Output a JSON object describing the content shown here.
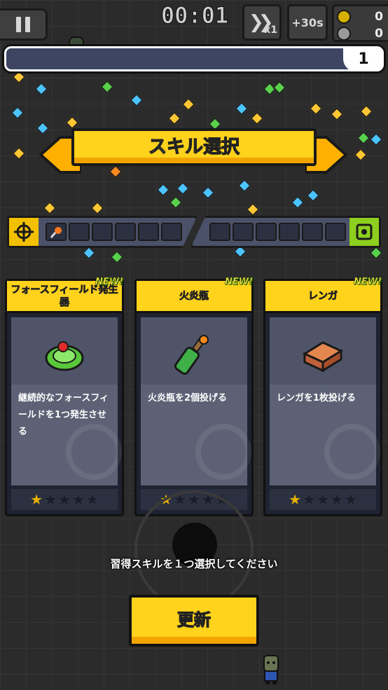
{
  "hud": {
    "timer": "00:01",
    "speed_label": "x1",
    "time_bonus_label": "+30s",
    "coin_count": "0",
    "kill_count": "0"
  },
  "exp": {
    "level": "1",
    "progress": 0.0
  },
  "banner": {
    "title": "スキル選択"
  },
  "slots": {
    "weapon_slot_count": 6,
    "passive_slot_count": 6
  },
  "cards": [
    {
      "badge": "NEW!",
      "name": "フォースフィールド発生器",
      "description": "継続的なフォースフィールドを1つ発生させる",
      "icon": "force-field-icon",
      "stars_filled": 1,
      "stars_total": 5
    },
    {
      "badge": "NEW!",
      "name": "火炎瓶",
      "description": "火炎瓶を2個投げる",
      "icon": "molotov-icon",
      "stars_filled": 1,
      "stars_total": 5
    },
    {
      "badge": "NEW!",
      "name": "レンガ",
      "description": "レンガを1枚投げる",
      "icon": "brick-icon",
      "stars_filled": 1,
      "stars_total": 5
    }
  ],
  "instruction": "習得スキルを１つ選択してください",
  "refresh_button": "更新",
  "colors": {
    "accent_yellow": "#ffd21c",
    "panel": "#4f5468",
    "exp_bar": "#3d4563",
    "passive_green": "#8dcf1e"
  }
}
